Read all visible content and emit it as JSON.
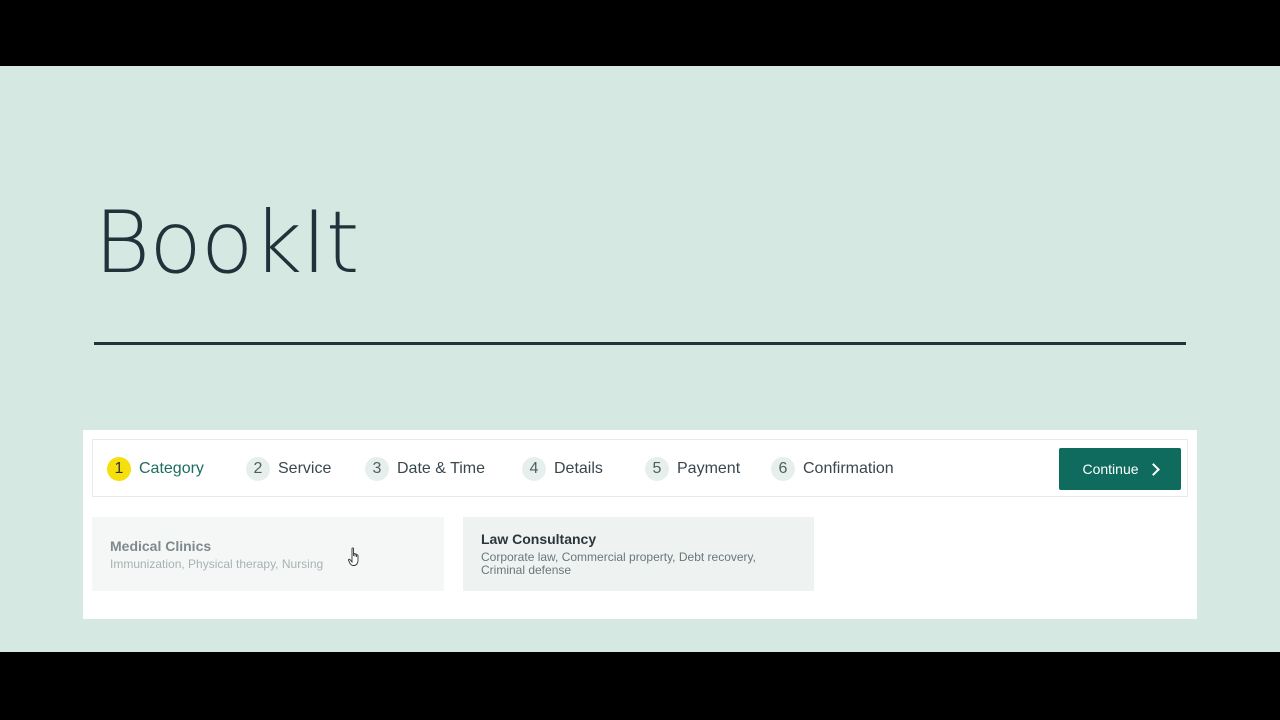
{
  "brand": {
    "title": "BookIt"
  },
  "steps": [
    {
      "number": "1",
      "label": "Category",
      "active": true
    },
    {
      "number": "2",
      "label": "Service",
      "active": false
    },
    {
      "number": "3",
      "label": "Date & Time",
      "active": false
    },
    {
      "number": "4",
      "label": "Details",
      "active": false
    },
    {
      "number": "5",
      "label": "Payment",
      "active": false
    },
    {
      "number": "6",
      "label": "Confirmation",
      "active": false
    }
  ],
  "continue_button": {
    "label": "Continue",
    "icon": "chevron-right-icon"
  },
  "categories": [
    {
      "title": "Medical Clinics",
      "description": "Immunization, Physical therapy, Nursing"
    },
    {
      "title": "Law Consultancy",
      "description": "Corporate law, Commercial property, Debt recovery, Criminal defense"
    }
  ],
  "colors": {
    "accent": "#0f6b5e",
    "active_step": "#f5df0d",
    "page_background": "#d5e8e1"
  }
}
